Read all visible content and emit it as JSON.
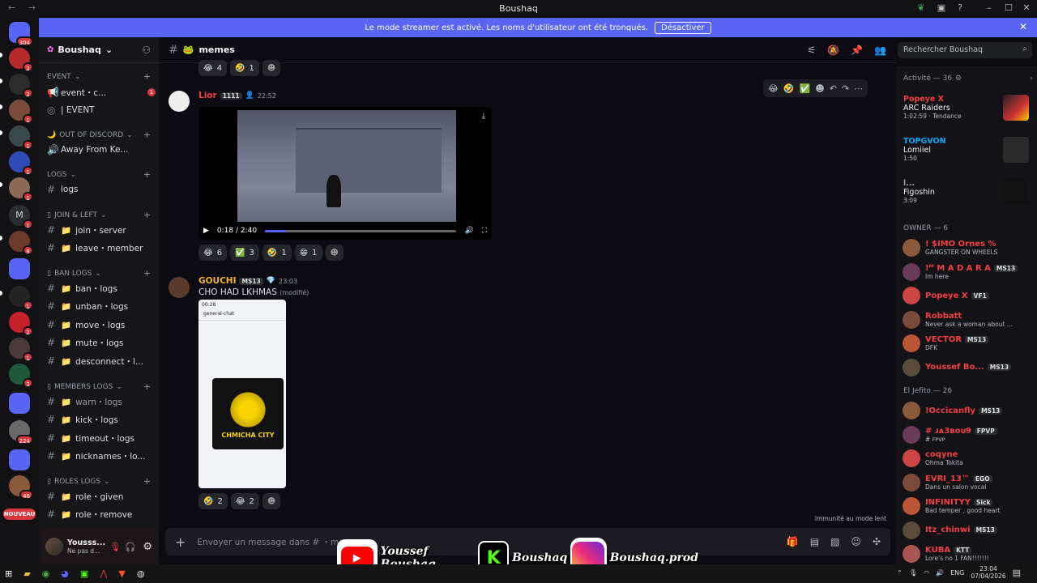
{
  "window": {
    "title": "Boushaq"
  },
  "banner": {
    "text": "Le mode streamer est activé. Les noms d'utilisateur ont été tronqués.",
    "button": "Désactiver"
  },
  "servers": {
    "home_badge": "304",
    "badges": [
      "2",
      "2",
      "1",
      "1",
      "1",
      "1",
      "9",
      "1",
      "2",
      "1",
      "3",
      "224",
      "46"
    ],
    "new_label": "NOUVEAU"
  },
  "guild": {
    "name": "Boushaq"
  },
  "channels": {
    "event_cat": "EVENT",
    "event_items": [
      "event・c...",
      "| EVENT"
    ],
    "event_badge": "1",
    "ood_cat": "OUT OF DISCORD",
    "ood_items": [
      "Away From Ke..."
    ],
    "logs_cat": "Logs",
    "logs_items": [
      "logs"
    ],
    "join_cat": "JOIN & LEFT",
    "join_items": [
      "join・server",
      "leave・member"
    ],
    "ban_cat": "BAN LOGS",
    "ban_items": [
      "ban・logs",
      "unban・logs",
      "move・logs",
      "mute・logs",
      "desconnect・l..."
    ],
    "members_cat": "MEMBERS LOGS",
    "members_items": [
      "warn・logs",
      "kick・logs",
      "timeout・logs",
      "nicknames・lo..."
    ],
    "roles_cat": "ROLES LOGS",
    "roles_items": [
      "role・given",
      "role・remove"
    ]
  },
  "user": {
    "name": "Yousss...",
    "status": "Ne pas d..."
  },
  "chat": {
    "channel": "memes",
    "top_reactions": [
      {
        "e": "😂",
        "n": "4"
      },
      {
        "e": "🤣",
        "n": "1"
      }
    ],
    "msg1": {
      "author": "Lior",
      "tag": "1111",
      "time": "22:52",
      "video_time": "0:18 / 2:40",
      "video_progress": 0.11
    },
    "msg1_reactions": [
      {
        "e": "😂",
        "n": "6"
      },
      {
        "e": "✅",
        "n": "3"
      },
      {
        "e": "🤣",
        "n": "1"
      },
      {
        "e": "😁",
        "n": "1"
      }
    ],
    "msg2": {
      "author": "GOUCHI",
      "tag": "MS13",
      "time": "23:03",
      "text": "CHO HAD LKHMAS",
      "edited": "(modifié)"
    },
    "shot": {
      "time": "00:28",
      "channel": "general-chat",
      "logo_text": "CHMICHA CITY"
    },
    "msg2_reactions": [
      {
        "e": "🤣",
        "n": "2"
      },
      {
        "e": "😂",
        "n": "2"
      }
    ],
    "composer_placeholder": "Envoyer un message dans #  ・memes",
    "slowmode": "Immunité au mode lent"
  },
  "search": {
    "placeholder": "Rechercher Boushaq"
  },
  "activity": {
    "header": "Activité — 36",
    "items": [
      {
        "user": "Popeye X",
        "game": "ARC Raiders",
        "time": "1:02:59",
        "extra": "Tendance"
      },
      {
        "user": "TOPGVON",
        "game": "Lomiiel",
        "time": "1:50",
        "extra": ""
      },
      {
        "user": "l...",
        "game": "Figoshin",
        "time": "3:09",
        "extra": ""
      }
    ]
  },
  "members": {
    "owner_header": "OWNER — 6",
    "owners": [
      {
        "name": "! $IMO Ornes %",
        "status": "GANGSTER ON WHEELS",
        "tag": "",
        "color": "#f23f43"
      },
      {
        "name": "!ᴹ M A D A R A",
        "status": "Im here",
        "tag": "MS13",
        "color": "#f23f43"
      },
      {
        "name": "Popeye X",
        "status": "",
        "tag": "VF1",
        "color": "#f23f43"
      },
      {
        "name": "Robbatt",
        "status": "Never ask a woman about ...",
        "tag": "",
        "color": "#f23f43"
      },
      {
        "name": "VECTOR",
        "status": "DFK",
        "tag": "MS13",
        "color": "#f23f43"
      },
      {
        "name": "Youssef Bo...",
        "status": "",
        "tag": "MS13",
        "color": "#f23f43"
      }
    ],
    "group_header": "El Jefito — 26",
    "group": [
      {
        "name": "!Occicanfly",
        "status": "",
        "tag": "MS13",
        "color": "#f23f43"
      },
      {
        "name": "# ᴊᴀ3ʙᴏᴜ9",
        "status": "# ꜰᴘᴠᴘ",
        "tag": "FPVP",
        "color": "#f23f43"
      },
      {
        "name": "coqyne",
        "status": "Ohma Tokita",
        "tag": "",
        "color": "#f23f43"
      },
      {
        "name": "EVRI_13™",
        "status": "Dans un salon vocal",
        "tag": "EGO",
        "color": "#f23f43"
      },
      {
        "name": "INFINITYY",
        "status": "Bad temper , good heart",
        "tag": "Sick",
        "color": "#f23f43"
      },
      {
        "name": "Itz_chinwi",
        "status": "",
        "tag": "MS13",
        "color": "#f23f43"
      },
      {
        "name": "KUBA",
        "status": "Lore's no 1 FAN!!!!!!!",
        "tag": "KTT",
        "color": "#f23f43"
      }
    ]
  },
  "overlay": {
    "youtube": "Youssef Boushaq",
    "kick": "Boushaq",
    "instagram": "Boushaq.prod"
  },
  "taskbar": {
    "lang": "ENG",
    "time": "23:04",
    "date": "07/04/2026"
  }
}
